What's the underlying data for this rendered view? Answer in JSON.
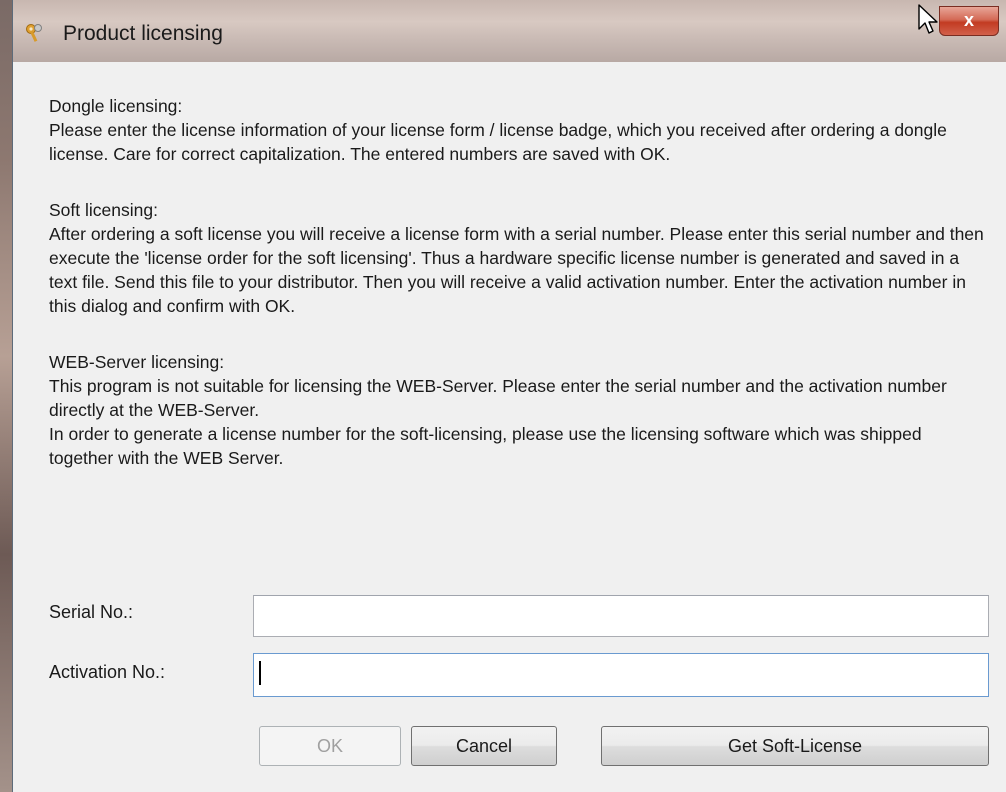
{
  "window": {
    "title": "Product licensing",
    "close_label": "x"
  },
  "intro": {
    "dongle_heading": "Dongle licensing:",
    "dongle_text": "Please enter the license information of your license form / license badge, which you received after ordering a dongle license. Care for correct capitalization. The entered numbers are saved with OK.",
    "soft_heading": "Soft licensing:",
    "soft_text": "After ordering a soft license you will receive a license form with a serial number. Please enter this serial number and then execute the 'license order for the soft licensing'. Thus a hardware specific license number is generated and saved in a text file. Send this file to your distributor. Then you will receive a valid activation number. Enter the activation number in this dialog and confirm with OK.",
    "web_heading": "WEB-Server licensing:",
    "web_text_1": "This program is not suitable for licensing the WEB-Server. Please enter the serial number and the activation number directly at the WEB-Server.",
    "web_text_2": "In order to generate a license number for the soft-licensing, please use the licensing software which was shipped together with the WEB Server."
  },
  "form": {
    "serial_label": "Serial No.:",
    "serial_value": "",
    "activation_label": "Activation No.:",
    "activation_value": ""
  },
  "buttons": {
    "ok": "OK",
    "cancel": "Cancel",
    "get_soft_license": "Get Soft-License"
  },
  "icons": {
    "title_icon": "keys-icon",
    "cursor": "mouse-pointer-icon"
  }
}
